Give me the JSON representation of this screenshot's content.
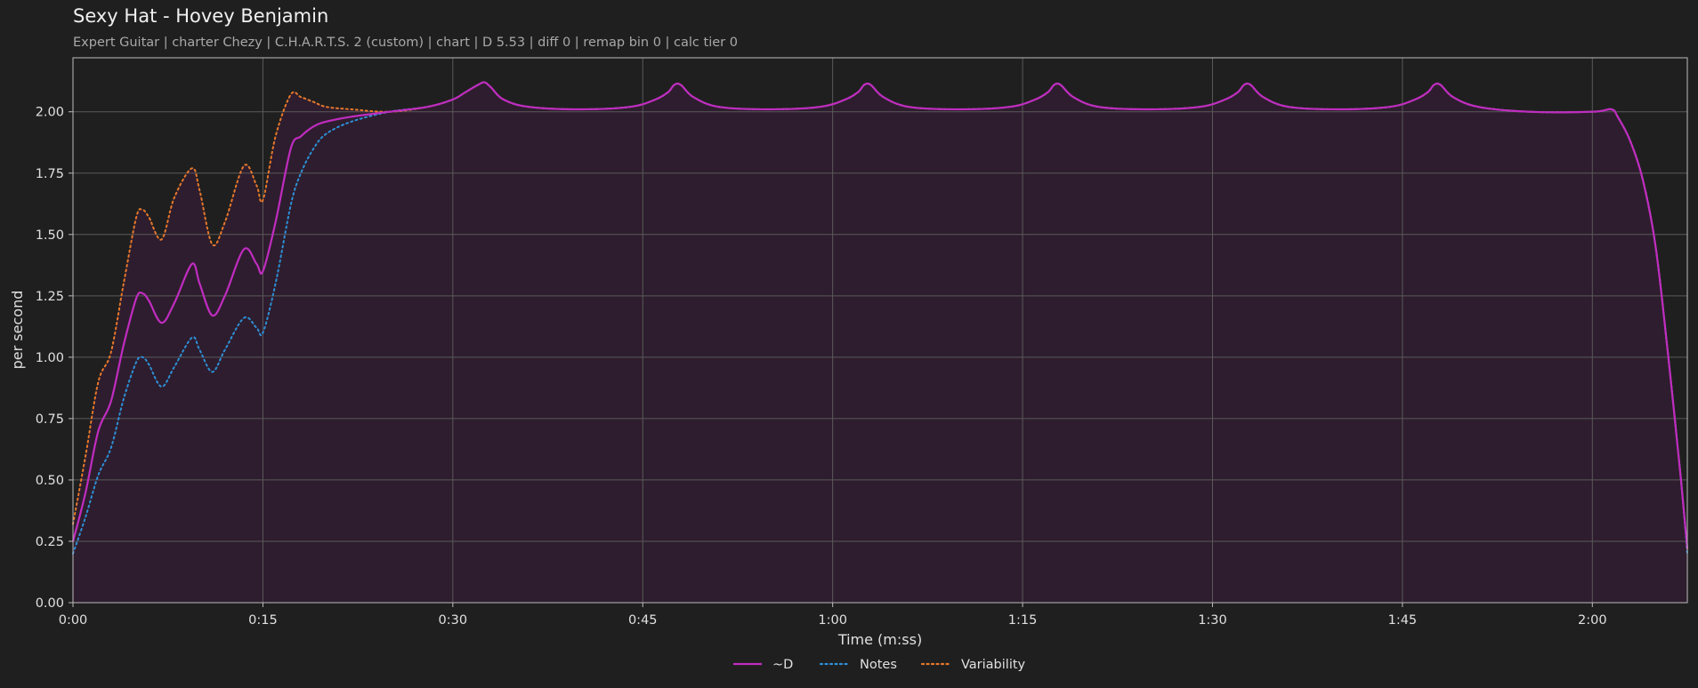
{
  "header": {
    "title": "Sexy Hat - Hovey Benjamin",
    "subtitle": "Expert Guitar  |  charter Chezy  |  C.H.A.R.T.S. 2 (custom)  |  chart  |  D 5.53  |  diff 0  |  remap bin 0  |  calc tier 0"
  },
  "colors": {
    "background": "#1f1f1f",
    "plot_fill": "#2e1d2e",
    "grid": "#5a5a5a",
    "d": "#c02cc0",
    "notes": "#2d8fd6",
    "variability": "#e6782c"
  },
  "chart_data": {
    "type": "line",
    "title": "Sexy Hat - Hovey Benjamin",
    "xlabel": "Time (m:ss)",
    "ylabel": "per second",
    "xlim": [
      0,
      127.5
    ],
    "ylim": [
      0,
      2.22
    ],
    "grid": true,
    "legend_placement": "bottom-center",
    "x_ticks": [
      {
        "value": 0,
        "label": "0:00"
      },
      {
        "value": 15,
        "label": "0:15"
      },
      {
        "value": 30,
        "label": "0:30"
      },
      {
        "value": 45,
        "label": "0:45"
      },
      {
        "value": 60,
        "label": "1:00"
      },
      {
        "value": 75,
        "label": "1:15"
      },
      {
        "value": 90,
        "label": "1:30"
      },
      {
        "value": 105,
        "label": "1:45"
      },
      {
        "value": 120,
        "label": "2:00"
      }
    ],
    "y_ticks": [
      {
        "value": 0,
        "label": "0.00"
      },
      {
        "value": 0.25,
        "label": "0.25"
      },
      {
        "value": 0.5,
        "label": "0.50"
      },
      {
        "value": 0.75,
        "label": "0.75"
      },
      {
        "value": 1.0,
        "label": "1.00"
      },
      {
        "value": 1.25,
        "label": "1.25"
      },
      {
        "value": 1.5,
        "label": "1.50"
      },
      {
        "value": 1.75,
        "label": "1.75"
      },
      {
        "value": 2.0,
        "label": "2.00"
      }
    ],
    "series": [
      {
        "name": "~D",
        "style": "solid",
        "color": "#c02cc0",
        "x": [
          0,
          1,
          2,
          3,
          4,
          5,
          5.5,
          6,
          7,
          8,
          9.4,
          10,
          11,
          12,
          13.5,
          14.5,
          15,
          16,
          17.2,
          18,
          19,
          20,
          22,
          25,
          28,
          30,
          31,
          32,
          32.5,
          33,
          34,
          36,
          40,
          44,
          46,
          47,
          47.5,
          48,
          49,
          51,
          55,
          59,
          61,
          62,
          62.5,
          63,
          64,
          66,
          70,
          74,
          76,
          77,
          77.5,
          78,
          79,
          81,
          85,
          89,
          91,
          92,
          92.5,
          93,
          94,
          96,
          100,
          104,
          106,
          107,
          107.5,
          108,
          109,
          111,
          115,
          120,
          121.5,
          122,
          123,
          124,
          125,
          126,
          127,
          127.5
        ],
        "values": [
          0.25,
          0.45,
          0.7,
          0.82,
          1.05,
          1.24,
          1.26,
          1.23,
          1.14,
          1.22,
          1.38,
          1.3,
          1.17,
          1.25,
          1.44,
          1.38,
          1.35,
          1.55,
          1.85,
          1.9,
          1.94,
          1.96,
          1.98,
          2.0,
          2.02,
          2.05,
          2.08,
          2.11,
          2.12,
          2.1,
          2.05,
          2.02,
          2.01,
          2.02,
          2.05,
          2.08,
          2.11,
          2.11,
          2.06,
          2.02,
          2.01,
          2.02,
          2.05,
          2.08,
          2.11,
          2.11,
          2.06,
          2.02,
          2.01,
          2.02,
          2.05,
          2.08,
          2.11,
          2.11,
          2.06,
          2.02,
          2.01,
          2.02,
          2.05,
          2.08,
          2.11,
          2.11,
          2.06,
          2.02,
          2.01,
          2.02,
          2.05,
          2.08,
          2.11,
          2.11,
          2.06,
          2.02,
          2.0,
          2.0,
          2.01,
          1.98,
          1.88,
          1.72,
          1.45,
          1.0,
          0.5,
          0.22
        ]
      },
      {
        "name": "Notes",
        "style": "dotted",
        "color": "#2d8fd6",
        "x": [
          0,
          1,
          2,
          3,
          4,
          5,
          5.5,
          6,
          7,
          8,
          9.4,
          10,
          11,
          12,
          13.5,
          14.5,
          15,
          16,
          17.2,
          18,
          19,
          20,
          22,
          25,
          28,
          30,
          31,
          32,
          32.5,
          33,
          34,
          36,
          40,
          44,
          46,
          47,
          47.5,
          48,
          49,
          51,
          55,
          59,
          61,
          62,
          62.5,
          63,
          64,
          66,
          70,
          74,
          76,
          77,
          77.5,
          78,
          79,
          81,
          85,
          89,
          91,
          92,
          92.5,
          93,
          94,
          96,
          100,
          104,
          106,
          107,
          107.5,
          108,
          109,
          111,
          115,
          120,
          121.5,
          122,
          123,
          124,
          125,
          126,
          127,
          127.5
        ],
        "values": [
          0.2,
          0.35,
          0.52,
          0.63,
          0.83,
          0.98,
          1.0,
          0.97,
          0.88,
          0.96,
          1.08,
          1.03,
          0.94,
          1.03,
          1.16,
          1.12,
          1.1,
          1.3,
          1.62,
          1.75,
          1.85,
          1.91,
          1.96,
          2.0,
          2.02,
          2.05,
          2.08,
          2.11,
          2.12,
          2.1,
          2.05,
          2.02,
          2.01,
          2.02,
          2.05,
          2.08,
          2.11,
          2.11,
          2.06,
          2.02,
          2.01,
          2.02,
          2.05,
          2.08,
          2.11,
          2.11,
          2.06,
          2.02,
          2.01,
          2.02,
          2.05,
          2.08,
          2.11,
          2.11,
          2.06,
          2.02,
          2.01,
          2.02,
          2.05,
          2.08,
          2.11,
          2.11,
          2.06,
          2.02,
          2.01,
          2.02,
          2.05,
          2.08,
          2.11,
          2.11,
          2.06,
          2.02,
          2.0,
          2.0,
          2.01,
          1.98,
          1.88,
          1.72,
          1.45,
          1.0,
          0.5,
          0.2
        ]
      },
      {
        "name": "Variability",
        "style": "dotted",
        "color": "#e6782c",
        "x": [
          0,
          1,
          2,
          3,
          4,
          5,
          5.5,
          6,
          7,
          8,
          9.4,
          10,
          11,
          12,
          13.5,
          14.5,
          15,
          16,
          17.2,
          18,
          19,
          20,
          22,
          25,
          28,
          30,
          31,
          32,
          32.5,
          33,
          34,
          36,
          40,
          44,
          46,
          47,
          47.5,
          48,
          49,
          51,
          55,
          59,
          61,
          62,
          62.5,
          63,
          64,
          66,
          70,
          74,
          76,
          77,
          77.5,
          78,
          79,
          81,
          85,
          89,
          91,
          92,
          92.5,
          93,
          94,
          96,
          100,
          104,
          106,
          107,
          107.5,
          108,
          109,
          111,
          115,
          120,
          121.5,
          122,
          123,
          124,
          125,
          126,
          127,
          127.5
        ],
        "values": [
          0.32,
          0.6,
          0.9,
          1.02,
          1.3,
          1.57,
          1.6,
          1.57,
          1.48,
          1.65,
          1.77,
          1.68,
          1.46,
          1.55,
          1.78,
          1.7,
          1.64,
          1.9,
          2.07,
          2.06,
          2.04,
          2.02,
          2.01,
          2.0,
          2.02,
          2.05,
          2.08,
          2.11,
          2.12,
          2.1,
          2.05,
          2.02,
          2.01,
          2.02,
          2.05,
          2.08,
          2.11,
          2.11,
          2.06,
          2.02,
          2.01,
          2.02,
          2.05,
          2.08,
          2.11,
          2.11,
          2.06,
          2.02,
          2.01,
          2.02,
          2.05,
          2.08,
          2.11,
          2.11,
          2.06,
          2.02,
          2.01,
          2.02,
          2.05,
          2.08,
          2.11,
          2.11,
          2.06,
          2.02,
          2.01,
          2.02,
          2.05,
          2.08,
          2.11,
          2.11,
          2.06,
          2.02,
          2.0,
          2.0,
          2.01,
          1.98,
          1.88,
          1.72,
          1.45,
          1.0,
          0.5,
          0.22
        ]
      }
    ]
  }
}
